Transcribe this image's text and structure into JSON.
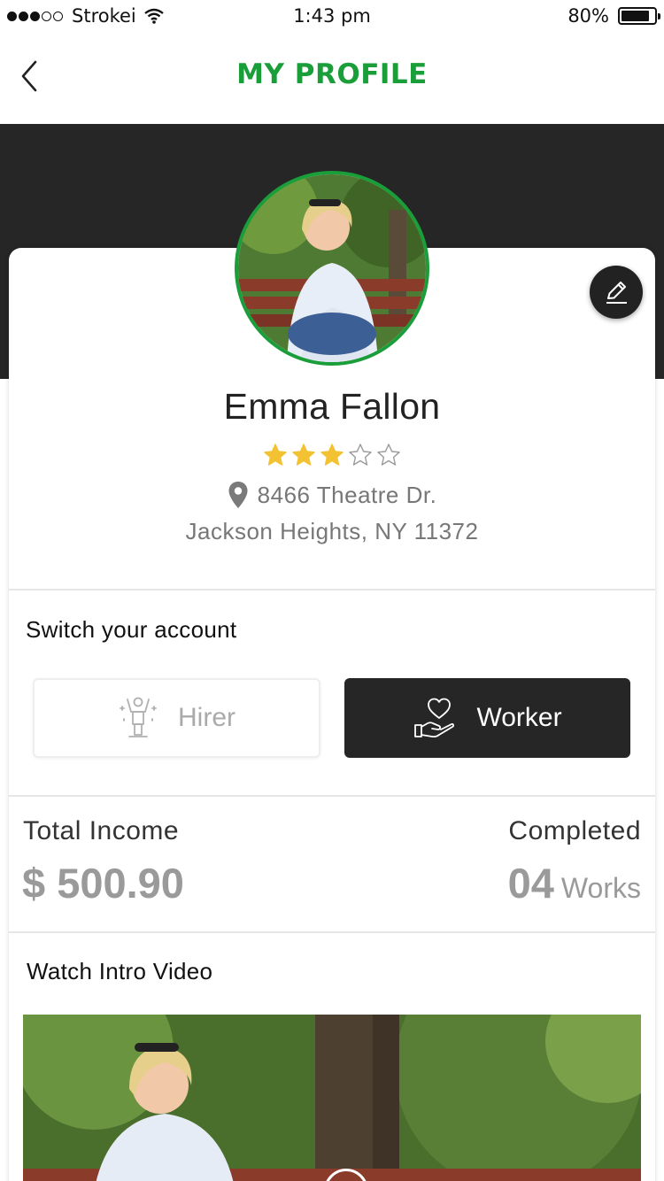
{
  "status_bar": {
    "carrier": "Strokei",
    "time": "1:43 pm",
    "battery": "80%"
  },
  "nav": {
    "title": "MY PROFILE",
    "back_icon": "chevron-left-icon"
  },
  "profile": {
    "name": "Emma Fallon",
    "rating": 3,
    "rating_max": 5,
    "address_line1": "8466 Theatre Dr.",
    "address_line2": "Jackson Heights, NY 11372",
    "edit_icon": "pencil-icon"
  },
  "switch_account": {
    "title": "Switch your account",
    "hirer_label": "Hirer",
    "worker_label": "Worker",
    "selected": "Worker"
  },
  "stats": {
    "income_label": "Total Income",
    "income_value": "$ 500.90",
    "completed_label": "Completed",
    "completed_value": "04",
    "completed_unit": "Works"
  },
  "video": {
    "title": "Watch Intro Video"
  },
  "colors": {
    "accent": "#1a9e3a",
    "dark": "#262626",
    "star": "#f2c232"
  }
}
